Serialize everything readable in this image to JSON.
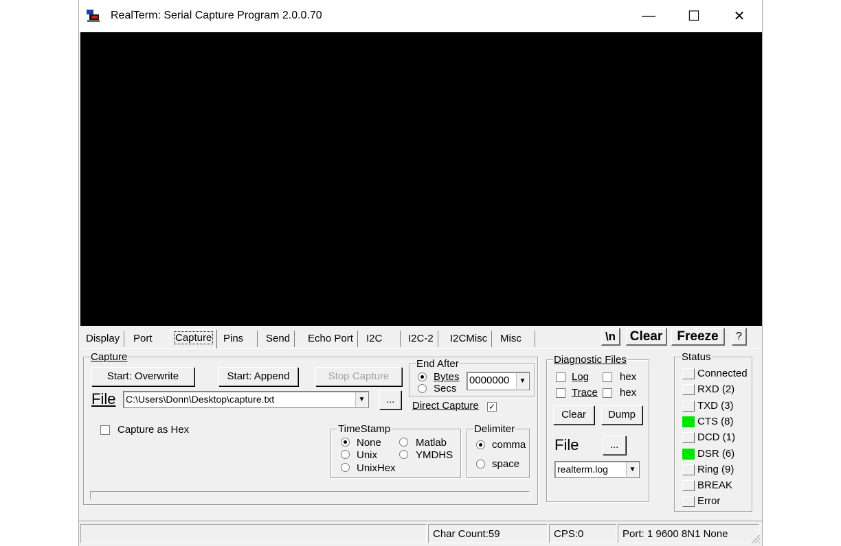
{
  "window": {
    "title": "RealTerm: Serial Capture Program 2.0.0.70",
    "controls": {
      "minimize": "—",
      "maximize": "☐",
      "close": "✕"
    }
  },
  "tabs": [
    "Display",
    "Port",
    "Capture",
    "Pins",
    "Send",
    "Echo Port",
    "I2C",
    "I2C-2",
    "I2CMisc",
    "Misc"
  ],
  "active_tab": "Capture",
  "toolbar": {
    "newline_label": "\\n",
    "clear_label": "Clear",
    "freeze_label": "Freeze",
    "help_label": "?"
  },
  "capture": {
    "group_label": "Capture",
    "start_overwrite": "Start: Overwrite",
    "start_append": "Start: Append",
    "stop_capture": "Stop Capture",
    "file_label": "File",
    "file_path": "C:\\Users\\Donn\\Desktop\\capture.txt",
    "browse_label": "...",
    "capture_as_hex": "Capture as Hex",
    "capture_as_hex_checked": false,
    "end_after": {
      "label": "End After",
      "bytes_label": "Bytes",
      "secs_label": "Secs",
      "selected": "Bytes",
      "value": "0000000"
    },
    "direct_capture_label": "Direct Capture",
    "direct_capture_checked": true,
    "timestamp": {
      "label": "TimeStamp",
      "options": [
        "None",
        "Matlab",
        "Unix",
        "YMDHS",
        "UnixHex"
      ],
      "selected": "None"
    },
    "delimiter": {
      "label": "Delimiter",
      "options": [
        "comma",
        "space"
      ],
      "selected": "comma"
    }
  },
  "diagnostic": {
    "group_label": "Diagnostic Files",
    "log_label": "Log",
    "trace_label": "Trace",
    "hex_label": "hex",
    "clear_label": "Clear",
    "dump_label": "Dump",
    "file_label": "File",
    "browse_label": "...",
    "file_value": "realterm.log"
  },
  "status": {
    "group_label": "Status",
    "items": [
      {
        "label": "Connected",
        "on": false
      },
      {
        "label": "RXD (2)",
        "on": false
      },
      {
        "label": "TXD (3)",
        "on": false
      },
      {
        "label": "CTS (8)",
        "on": true
      },
      {
        "label": "DCD (1)",
        "on": false
      },
      {
        "label": "DSR (6)",
        "on": true
      },
      {
        "label": "Ring (9)",
        "on": false
      },
      {
        "label": "BREAK",
        "on": false
      },
      {
        "label": "Error",
        "on": false
      }
    ],
    "led_on_color": "#00e600"
  },
  "statusbar": {
    "char_count": "Char Count:59",
    "cps": "CPS:0",
    "port": "Port: 1 9600 8N1 None"
  },
  "colors": {
    "terminal_bg": "#000000",
    "window_bg": "#f0f0f0"
  }
}
